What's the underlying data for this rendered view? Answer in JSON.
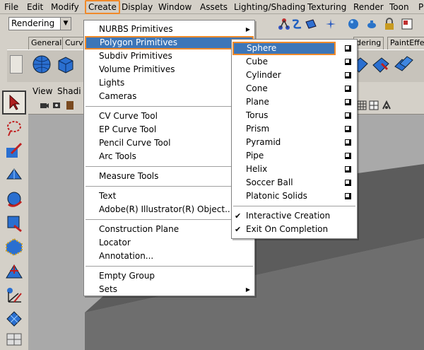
{
  "menubar": {
    "items": [
      "File",
      "Edit",
      "Modify",
      "Create",
      "Display",
      "Window",
      "Assets",
      "Lighting/Shading",
      "Texturing",
      "Render",
      "Toon",
      "P"
    ],
    "active": "Create",
    "highlight_color": "#f08a2a"
  },
  "statusline": {
    "menuset": "Rendering",
    "icons": [
      "magnet-icon",
      "curve-snap-icon",
      "plane-icon",
      "render-icon",
      "lock-icon",
      "ipr-icon"
    ]
  },
  "shelf": {
    "tabs": [
      "General",
      "Curve",
      "dering",
      "PaintEffects"
    ],
    "icons": [
      "poly-sphere-icon",
      "poly-cube-icon"
    ]
  },
  "toolbox": {
    "tools": [
      "select-tool-icon",
      "lasso-tool-icon",
      "paint-select-tool-icon",
      "move-tool-icon",
      "rotate-tool-icon",
      "scale-tool-icon",
      "manipulator-icon",
      "soft-mod-icon",
      "axis-icon",
      "grid-layout-icon"
    ]
  },
  "panel": {
    "menus": [
      "View",
      "Shadi"
    ]
  },
  "create_menu": {
    "items": [
      {
        "label": "NURBS Primitives",
        "submenu": true
      },
      {
        "label": "Polygon Primitives",
        "submenu": true,
        "highlighted": true
      },
      {
        "label": "Subdiv Primitives",
        "submenu": true
      },
      {
        "label": "Volume Primitives",
        "submenu": true
      },
      {
        "label": "Lights",
        "submenu": true
      },
      {
        "label": "Cameras",
        "submenu": true
      },
      {
        "separator": true
      },
      {
        "label": "CV Curve Tool"
      },
      {
        "label": "EP Curve Tool"
      },
      {
        "label": "Pencil Curve Tool"
      },
      {
        "label": "Arc Tools",
        "submenu": true
      },
      {
        "separator": true
      },
      {
        "label": "Measure Tools",
        "submenu": true
      },
      {
        "separator": true
      },
      {
        "label": "Text"
      },
      {
        "label": "Adobe(R) Illustrator(R) Object..."
      },
      {
        "separator": true
      },
      {
        "label": "Construction Plane"
      },
      {
        "label": "Locator"
      },
      {
        "label": "Annotation..."
      },
      {
        "separator": true
      },
      {
        "label": "Empty Group"
      },
      {
        "label": "Sets",
        "submenu": true
      }
    ]
  },
  "polygon_primitives_menu": {
    "items": [
      {
        "label": "Sphere",
        "option_box": true,
        "highlighted": true
      },
      {
        "label": "Cube",
        "option_box": true
      },
      {
        "label": "Cylinder",
        "option_box": true
      },
      {
        "label": "Cone",
        "option_box": true
      },
      {
        "label": "Plane",
        "option_box": true
      },
      {
        "label": "Torus",
        "option_box": true
      },
      {
        "label": "Prism",
        "option_box": true
      },
      {
        "label": "Pyramid",
        "option_box": true
      },
      {
        "label": "Pipe",
        "option_box": true
      },
      {
        "label": "Helix",
        "option_box": true
      },
      {
        "label": "Soccer Ball",
        "option_box": true
      },
      {
        "label": "Platonic Solids",
        "option_box": true
      },
      {
        "separator": true
      },
      {
        "label": "Interactive Creation",
        "checked": true
      },
      {
        "label": "Exit On Completion",
        "checked": true
      }
    ]
  }
}
